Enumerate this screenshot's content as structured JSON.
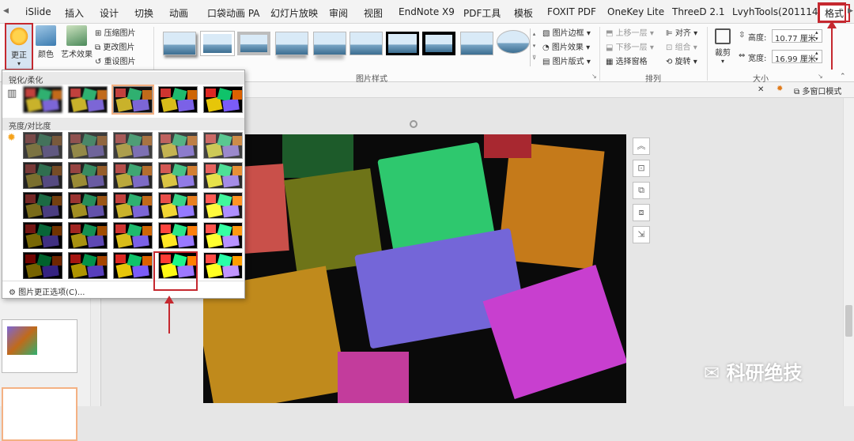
{
  "tabs": [
    "iSlide",
    "插入",
    "设计",
    "切换",
    "动画",
    "口袋动画 PA",
    "幻灯片放映",
    "审阅",
    "视图",
    "EndNote X9",
    "PDF工具",
    "模板",
    "FOXIT PDF",
    "OneKey Lite",
    "ThreeD 2.1",
    "LvyhTools(201114)",
    "格式"
  ],
  "ribbon": {
    "adjust": {
      "correct_label": "更正",
      "color_label": "颜色",
      "art_label": "艺术效果",
      "compress": "压缩图片",
      "change": "更改图片",
      "reset": "重设图片"
    },
    "styles_group": "图片样式",
    "border": "图片边框",
    "effect": "图片效果",
    "layout": "图片版式",
    "bring_forward": "上移一层",
    "send_backward": "下移一层",
    "selection_pane": "选择窗格",
    "align": "对齐",
    "group": "组合",
    "rotate": "旋转",
    "arrange_group": "排列",
    "crop_label": "裁剪",
    "height_label": "高度:",
    "height_value": "10.77 厘米",
    "width_label": "宽度:",
    "width_value": "16.99 厘米",
    "size_group": "大小"
  },
  "subbar": {
    "multiwindow": "多窗口模式"
  },
  "popup": {
    "sharpen_title": "锐化/柔化",
    "bright_title": "亮度/对比度",
    "options_label": "图片更正选项(C)..."
  },
  "watermark": "科研绝技",
  "colors": {
    "accent": "#c5282f",
    "selected": "#f4b183"
  }
}
